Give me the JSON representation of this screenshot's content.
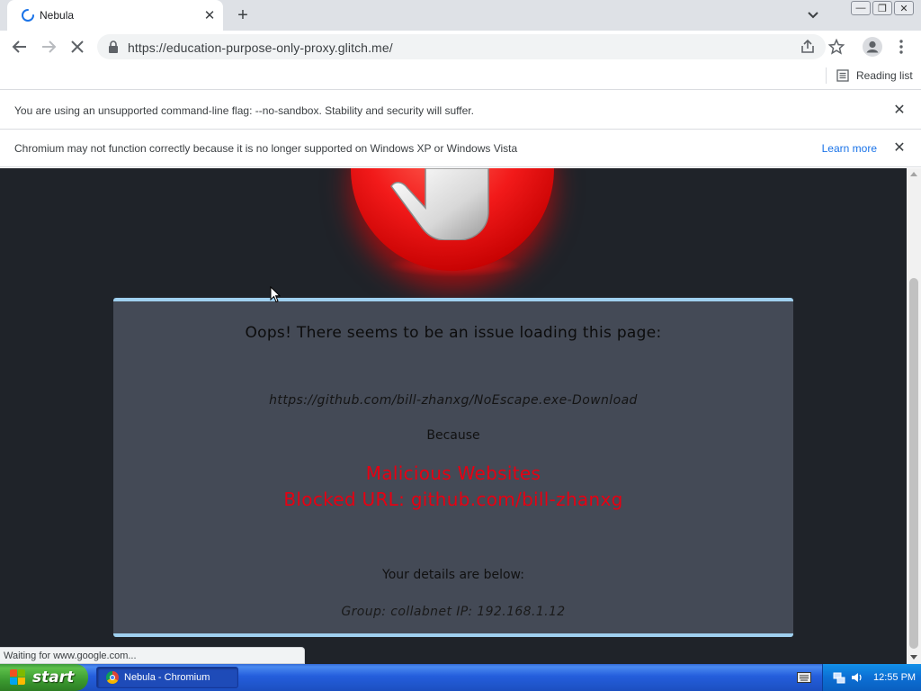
{
  "browser": {
    "tab": {
      "title": "Nebula"
    },
    "url": "https://education-purpose-only-proxy.glitch.me/",
    "reading_list_label": "Reading list"
  },
  "infobars": [
    {
      "message": "You are using an unsupported command-line flag: --no-sandbox. Stability and security will suffer."
    },
    {
      "message": "Chromium may not function correctly because it is no longer supported on Windows XP or Windows Vista",
      "link": "Learn more"
    }
  ],
  "page": {
    "heading": "Oops! There seems to be an issue loading this page:",
    "blocked_url": "https://github.com/bill-zhanxg/NoEscape.exe-Download",
    "because": "Because",
    "reason_category": "Malicious Websites",
    "reason_detail": "Blocked URL: github.com/bill-zhanxg",
    "details_heading": "Your details are below:",
    "group_ip": "Group: collabnet   IP: 192.168.1.12"
  },
  "status_bubble": "Waiting for www.google.com...",
  "taskbar": {
    "start_label": "start",
    "window_label": "Nebula - Chromium",
    "clock": "12:55 PM"
  },
  "colors": {
    "page_bg": "#1f2329",
    "panel_bg": "#444a56",
    "panel_border": "#9fd0ef",
    "warning_red": "#e60012",
    "link_blue": "#1a73e8"
  }
}
